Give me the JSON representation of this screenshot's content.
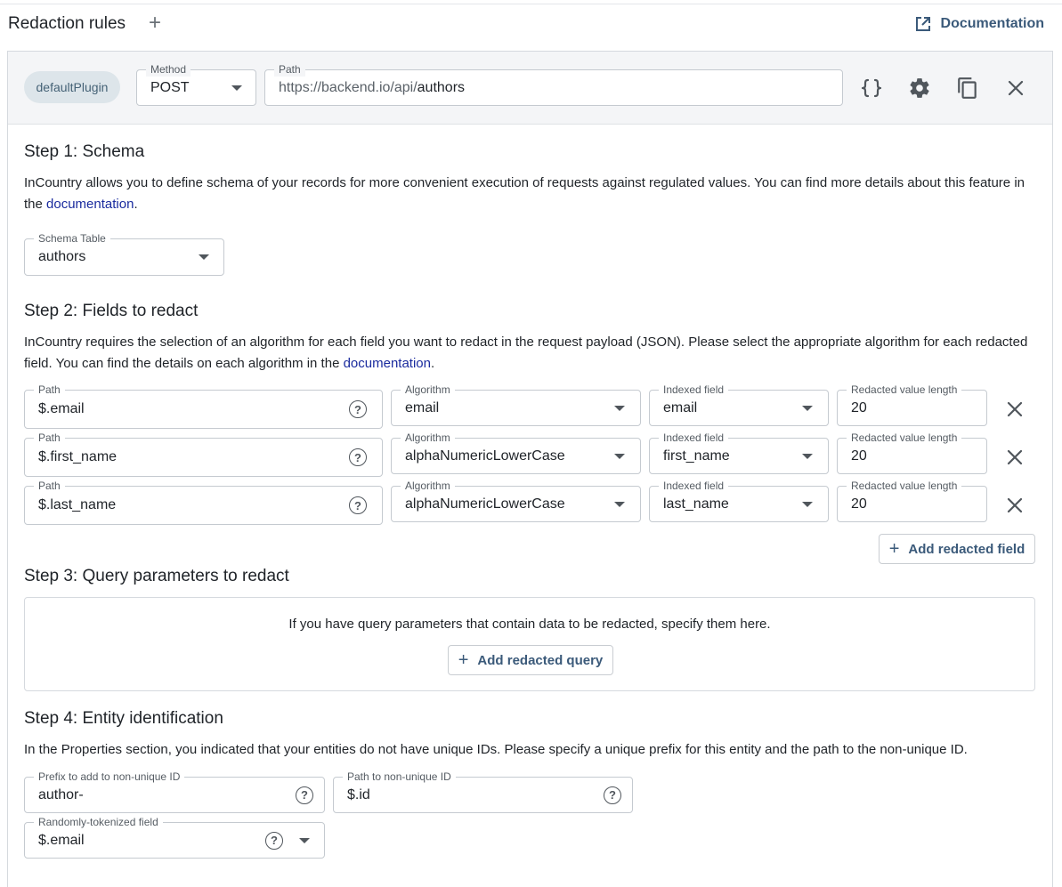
{
  "header": {
    "title": "Redaction rules",
    "add_icon": "plus-icon",
    "documentation_label": "Documentation"
  },
  "rule": {
    "plugin": "defaultPlugin",
    "method": {
      "label": "Method",
      "value": "POST"
    },
    "path": {
      "label": "Path",
      "base": "https://backend.io/api/",
      "endpoint": "authors"
    },
    "icons": [
      "braces-icon",
      "gear-icon",
      "copy-icon",
      "close-icon"
    ]
  },
  "step1": {
    "title": "Step 1: Schema",
    "description": "InCountry allows you to define schema of your records for more convenient execution of requests against regulated values. You can find more details about this feature in the ",
    "link": "documentation",
    "after": ".",
    "schema_table": {
      "label": "Schema Table",
      "value": "authors"
    }
  },
  "step2": {
    "title": "Step 2: Fields to redact",
    "description": "InCountry requires the selection of an algorithm for each field you want to redact in the request payload (JSON). Please select the appropriate algorithm for each redacted field. You can find the details on each algorithm in the ",
    "link": "documentation",
    "after": ".",
    "labels": {
      "path": "Path",
      "algorithm": "Algorithm",
      "indexed": "Indexed field",
      "length": "Redacted value length"
    },
    "rows": [
      {
        "path": "$.email",
        "algorithm": "email",
        "indexed": "email",
        "length": "20"
      },
      {
        "path": "$.first_name",
        "algorithm": "alphaNumericLowerCase",
        "indexed": "first_name",
        "length": "20"
      },
      {
        "path": "$.last_name",
        "algorithm": "alphaNumericLowerCase",
        "indexed": "last_name",
        "length": "20"
      }
    ],
    "add_label": "Add redacted field"
  },
  "step3": {
    "title": "Step 3: Query parameters to redact",
    "empty_message": "If you have query parameters that contain data to be redacted, specify them here.",
    "add_label": "Add redacted query"
  },
  "step4": {
    "title": "Step 4: Entity identification",
    "description": "In the Properties section, you indicated that your entities do not have unique IDs. Please specify a unique prefix for this entity and the path to the non-unique ID.",
    "prefix": {
      "label": "Prefix to add to non-unique ID",
      "value": "author-"
    },
    "id_path": {
      "label": "Path to non-unique ID",
      "value": "$.id"
    },
    "tokenized": {
      "label": "Randomly-tokenized field",
      "value": "$.email"
    }
  }
}
